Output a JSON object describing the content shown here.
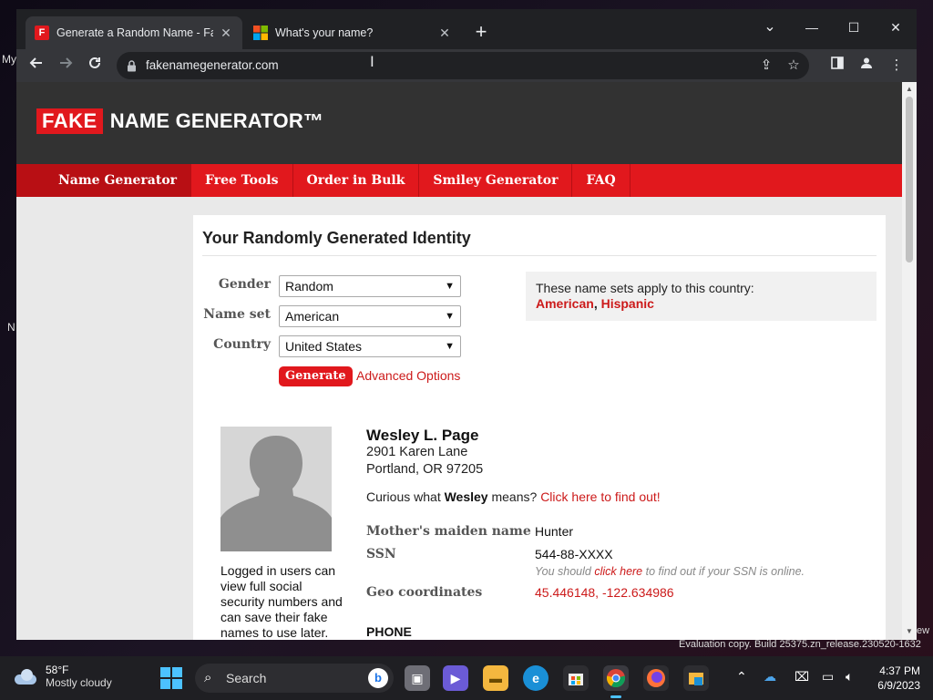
{
  "desktop": {
    "left_fragments": [
      "My",
      "N"
    ],
    "right_fragment": "ew"
  },
  "browser": {
    "tabs": [
      {
        "favicon_letter": "F",
        "title": "Generate a Random Name - Fake",
        "active": true
      },
      {
        "favicon_letter": "",
        "title": "What's your name?",
        "active": false
      }
    ],
    "url": "fakenamegenerator.com",
    "window_controls": {
      "dropdown": "⌄",
      "minimize": "—",
      "maximize": "☐",
      "close": "✕"
    }
  },
  "site": {
    "logo_fake": "FAKE",
    "logo_rest": "NAME GENERATOR™",
    "nav": [
      "Name Generator",
      "Free Tools",
      "Order in Bulk",
      "Smiley Generator",
      "FAQ"
    ],
    "active_nav": "Name Generator"
  },
  "form": {
    "heading": "Your Randomly Generated Identity",
    "gender_label": "Gender",
    "gender_value": "Random",
    "nameset_label": "Name set",
    "nameset_value": "American",
    "country_label": "Country",
    "country_value": "United States",
    "generate_label": "Generate",
    "advanced_label": "Advanced Options",
    "info_text": "These name sets apply to this country:",
    "info_link1": "American",
    "info_sep": ", ",
    "info_link2": "Hispanic"
  },
  "identity": {
    "name": "Wesley L. Page",
    "street": "2901 Karen Lane",
    "city": "Portland, OR 97205",
    "curious_prefix": "Curious what ",
    "curious_name": "Wesley",
    "curious_mid": " means? ",
    "curious_link": "Click here to find out!",
    "avatar_note": "Logged in users can view full social security numbers and can save their fake names to use later.",
    "maiden_label": "Mother's maiden name",
    "maiden_value": "Hunter",
    "ssn_label": "SSN",
    "ssn_value": "544-88-XXXX",
    "ssn_note_prefix": "You should ",
    "ssn_note_link": "click here",
    "ssn_note_suffix": " to find out if your SSN is online.",
    "geo_label": "Geo coordinates",
    "geo_value": "45.446148, -122.634986",
    "phone_heading": "PHONE"
  },
  "watermark": "Evaluation copy. Build 25375.zn_release.230520-1632",
  "taskbar": {
    "temp": "58°F",
    "weather": "Mostly cloudy",
    "search_label": "Search",
    "time": "4:37 PM",
    "date": "6/9/2023"
  },
  "colors": {
    "brand_red": "#e1181d",
    "header_dark": "#323232",
    "link_red": "#cc1a1a"
  }
}
